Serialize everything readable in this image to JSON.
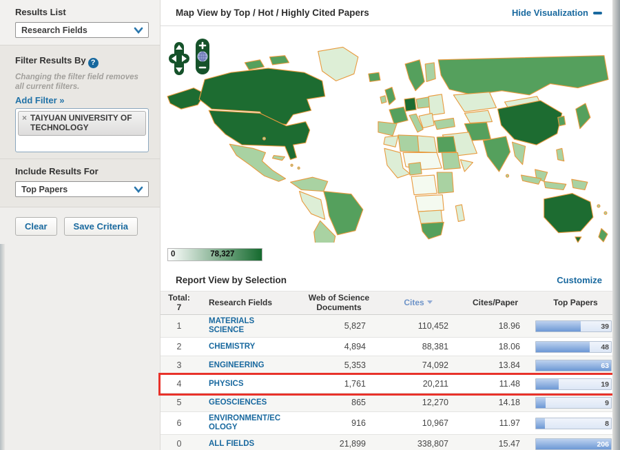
{
  "sidebar": {
    "results_list": {
      "heading": "Results List",
      "selected_option": "Research Fields"
    },
    "filter": {
      "heading": "Filter Results By",
      "help_badge": "?",
      "note": "Changing the filter field removes all current filters.",
      "add_filter_link": "Add Filter »",
      "active_filters": [
        {
          "remove_glyph": "×",
          "label": "TAIYUAN UNIVERSITY OF TECHNOLOGY"
        }
      ]
    },
    "include_results": {
      "heading": "Include Results For",
      "selected_option": "Top Papers"
    },
    "actions": {
      "clear_label": "Clear",
      "save_label": "Save Criteria"
    }
  },
  "map_panel": {
    "title": "Map View by Top / Hot / Highly Cited Papers",
    "hide_link_label": "Hide Visualization",
    "legend": {
      "min_label": "0",
      "max_label": "78,327"
    },
    "controls": {
      "zoom_in": "+",
      "zoom_out": "−"
    }
  },
  "report_panel": {
    "title": "Report View by Selection",
    "customize_link_label": "Customize",
    "table": {
      "total_label": "Total:",
      "total_count": "7",
      "sorted_by": "Cites",
      "headers": {
        "field": "Research Fields",
        "docs": "Web of Science Documents",
        "cites": "Cites",
        "cites_per_paper": "Cites/Paper",
        "top_papers": "Top Papers"
      },
      "rows": [
        {
          "rank": "1",
          "field": "MATERIALS SCIENCE",
          "docs": "5,827",
          "cites": "110,452",
          "cites_per_paper": "18.96",
          "top_papers": "39",
          "bar_fill_pct": 60,
          "highlighted": false
        },
        {
          "rank": "2",
          "field": "CHEMISTRY",
          "docs": "4,894",
          "cites": "88,381",
          "cites_per_paper": "18.06",
          "top_papers": "48",
          "bar_fill_pct": 72,
          "highlighted": false
        },
        {
          "rank": "3",
          "field": "ENGINEERING",
          "docs": "5,353",
          "cites": "74,092",
          "cites_per_paper": "13.84",
          "top_papers": "63",
          "bar_fill_pct": 100,
          "highlighted": false
        },
        {
          "rank": "4",
          "field": "PHYSICS",
          "docs": "1,761",
          "cites": "20,211",
          "cites_per_paper": "11.48",
          "top_papers": "19",
          "bar_fill_pct": 30,
          "highlighted": true
        },
        {
          "rank": "5",
          "field": "GEOSCIENCES",
          "docs": "865",
          "cites": "12,270",
          "cites_per_paper": "14.18",
          "top_papers": "9",
          "bar_fill_pct": 13,
          "highlighted": false
        },
        {
          "rank": "6",
          "field": "ENVIRONMENT/ECOLOGY",
          "docs": "916",
          "cites": "10,967",
          "cites_per_paper": "11.97",
          "top_papers": "8",
          "bar_fill_pct": 12,
          "highlighted": false
        },
        {
          "rank": "0",
          "field": "ALL FIELDS",
          "docs": "21,899",
          "cites": "338,807",
          "cites_per_paper": "15.47",
          "top_papers": "206",
          "bar_fill_pct": 100,
          "highlighted": false
        }
      ]
    }
  },
  "appearance": {
    "accent_blue": "#19699f",
    "highlight_red": "#e8322a",
    "map_border_orange": "#e89a3e",
    "choropleth_scale": [
      "#f4faf0",
      "#ddeed6",
      "#a9d2a2",
      "#55a05d",
      "#1d6c31"
    ],
    "legend_gradient": [
      "#ffffff",
      "#156a2e"
    ],
    "bar_fill_blue": "#6d98d5"
  }
}
